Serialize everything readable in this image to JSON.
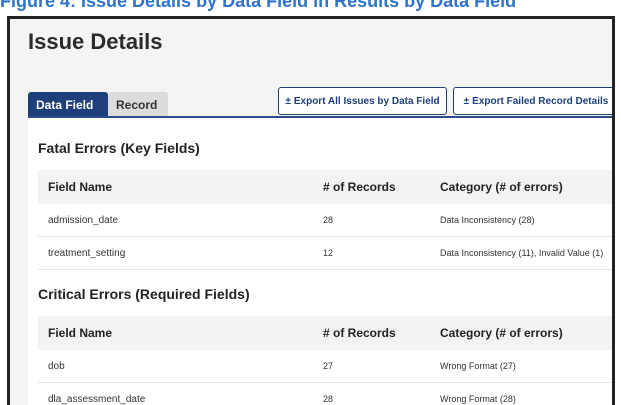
{
  "caption": "Figure 4: Issue Details by Data Field in Results by Data Field",
  "panel": {
    "title": "Issue Details"
  },
  "tabs": [
    {
      "label": "Data Field",
      "active": true
    },
    {
      "label": "Record",
      "active": false
    }
  ],
  "buttons": {
    "export_all": {
      "icon": "±",
      "label": "Export All Issues by Data Field"
    },
    "export_failed": {
      "icon": "±",
      "label": "Export Failed Record Details"
    }
  },
  "sections": [
    {
      "title": "Fatal Errors (Key Fields)",
      "headers": [
        "Field Name",
        "# of Records",
        "Category (# of errors)"
      ],
      "rows": [
        {
          "field": "admission_date",
          "records": "28",
          "category": "Data Inconsistency (28)"
        },
        {
          "field": "treatment_setting",
          "records": "12",
          "category": "Data Inconsistency (11), Invalid Value (1)"
        }
      ]
    },
    {
      "title": "Critical Errors (Required Fields)",
      "headers": [
        "Field Name",
        "# of Records",
        "Category (# of errors)"
      ],
      "rows": [
        {
          "field": "dob",
          "records": "27",
          "category": "Wrong Format (27)"
        },
        {
          "field": "dla_assessment_date",
          "records": "28",
          "category": "Wrong Format (28)"
        }
      ]
    }
  ],
  "colors": {
    "accent": "#1e3f7a",
    "caption": "#2e75c9"
  }
}
